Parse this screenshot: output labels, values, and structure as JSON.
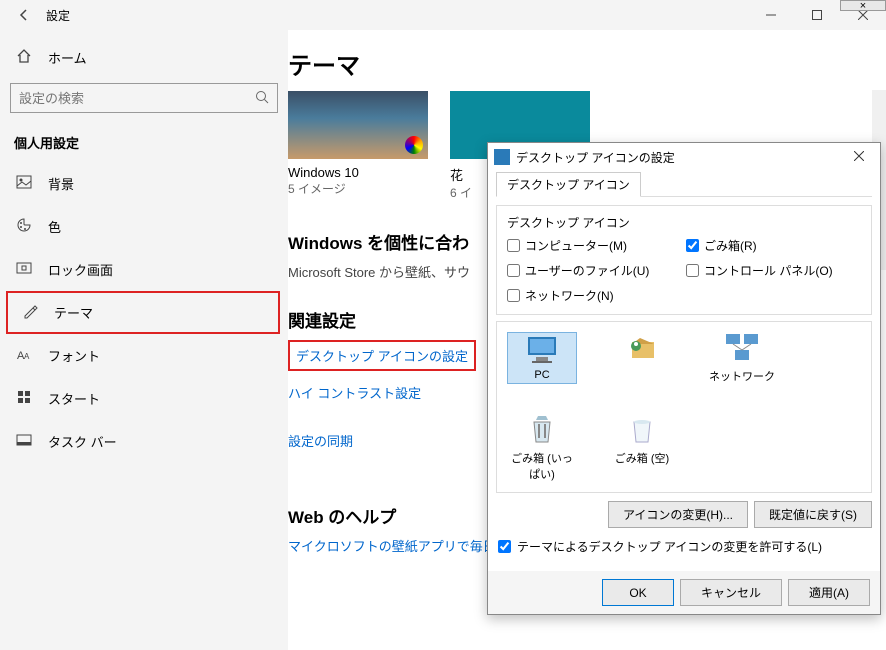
{
  "corner": "×",
  "titlebar": {
    "title": "設定"
  },
  "sidebar": {
    "home": "ホーム",
    "search_placeholder": "設定の検索",
    "section": "個人用設定",
    "items": [
      {
        "icon": "background-icon",
        "label": "背景"
      },
      {
        "icon": "color-icon",
        "label": "色"
      },
      {
        "icon": "lock-icon",
        "label": "ロック画面"
      },
      {
        "icon": "theme-icon",
        "label": "テーマ",
        "active": true
      },
      {
        "icon": "font-icon",
        "label": "フォント"
      },
      {
        "icon": "start-icon",
        "label": "スタート"
      },
      {
        "icon": "taskbar-icon",
        "label": "タスク バー"
      }
    ]
  },
  "main": {
    "heading": "テーマ",
    "themes": [
      {
        "name": "Windows 10",
        "count": "5 イメージ",
        "colorwheel": true
      },
      {
        "name": "花",
        "count": "6 イ",
        "style": "flower"
      }
    ],
    "personalize_heading": "Windows を個性に合わ",
    "personalize_sub": "Microsoft Store から壁紙、サウ",
    "related_heading": "関連設定",
    "links": [
      {
        "label": "デスクトップ アイコンの設定",
        "boxed": true
      },
      {
        "label": "ハイ コントラスト設定"
      },
      {
        "label": "設定の同期"
      }
    ],
    "web_help_heading": "Web のヘルプ",
    "web_help_link": "マイクロソフトの壁紙アプリで毎日"
  },
  "dialog": {
    "title": "デスクトップ アイコンの設定",
    "tab": "デスクトップ アイコン",
    "group_label": "デスクトップ アイコン",
    "checks": [
      {
        "label": "コンピューター(M)",
        "checked": false
      },
      {
        "label": "ごみ箱(R)",
        "checked": true
      },
      {
        "label": "ユーザーのファイル(U)",
        "checked": false
      },
      {
        "label": "コントロール パネル(O)",
        "checked": false
      },
      {
        "label": "ネットワーク(N)",
        "checked": false
      }
    ],
    "icons": [
      {
        "label": "PC",
        "kind": "pc",
        "selected": true
      },
      {
        "label": "",
        "kind": "user"
      },
      {
        "label": "ネットワーク",
        "kind": "network"
      },
      {
        "label": "ごみ箱 (いっぱい)",
        "kind": "bin-full"
      },
      {
        "label": "ごみ箱 (空)",
        "kind": "bin-empty"
      }
    ],
    "btn_change": "アイコンの変更(H)...",
    "btn_restore": "既定値に戻す(S)",
    "allow_theme": "テーマによるデスクトップ アイコンの変更を許可する(L)",
    "allow_checked": true,
    "btn_ok": "OK",
    "btn_cancel": "キャンセル",
    "btn_apply": "適用(A)"
  }
}
